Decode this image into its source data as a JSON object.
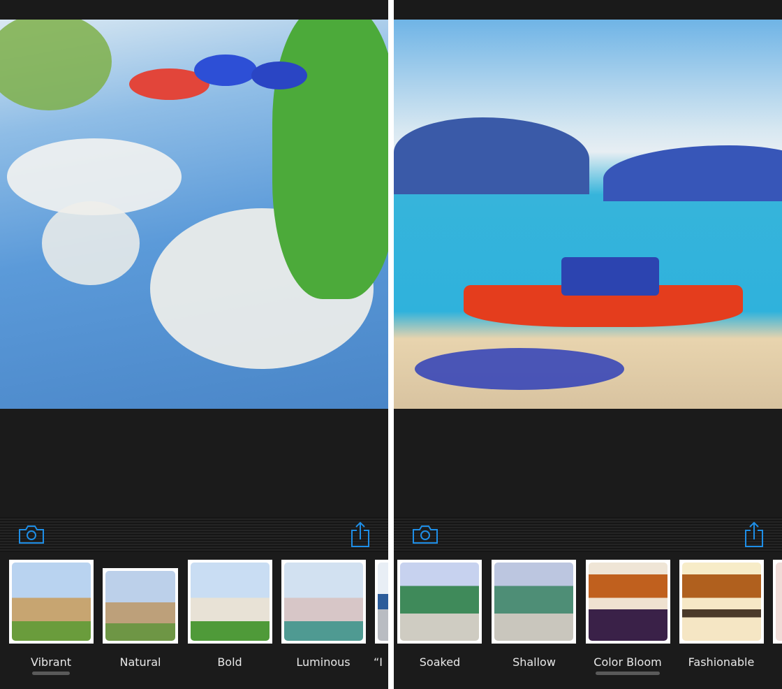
{
  "left_screen": {
    "photo": "watercolor boats among reeds with cloud reflections",
    "toolbar": {
      "camera_icon": "camera-icon",
      "share_icon": "share-icon"
    },
    "styles": [
      {
        "label": "Vibrant",
        "selected": true
      },
      {
        "label": "Natural",
        "selected": false
      },
      {
        "label": "Bold",
        "selected": false
      },
      {
        "label": "Luminous",
        "selected": false
      },
      {
        "label": "“I",
        "selected": false
      }
    ]
  },
  "right_screen": {
    "photo": "watercolor red boat on beach with bay and hills",
    "toolbar": {
      "camera_icon": "camera-icon",
      "share_icon": "share-icon"
    },
    "styles": [
      {
        "label": "Soaked",
        "selected": false
      },
      {
        "label": "Shallow",
        "selected": false
      },
      {
        "label": "Color Bloom",
        "selected": true
      },
      {
        "label": "Fashionable",
        "selected": false
      }
    ]
  },
  "colors": {
    "accent": "#1e8ee6",
    "background": "#1b1b1b",
    "selection": "#5a5a5a"
  }
}
